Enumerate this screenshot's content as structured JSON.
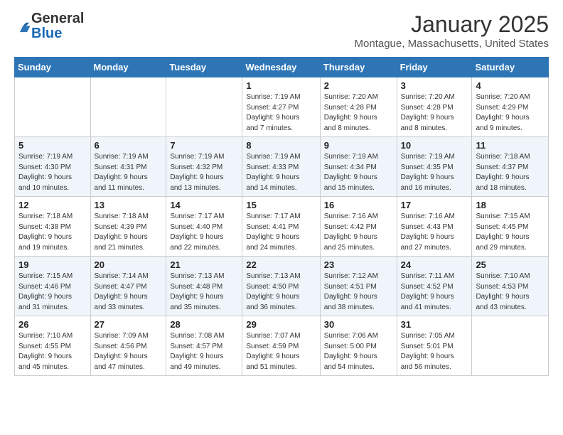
{
  "logo": {
    "general": "General",
    "blue": "Blue"
  },
  "header": {
    "month": "January 2025",
    "location": "Montague, Massachusetts, United States"
  },
  "weekdays": [
    "Sunday",
    "Monday",
    "Tuesday",
    "Wednesday",
    "Thursday",
    "Friday",
    "Saturday"
  ],
  "weeks": [
    [
      {
        "day": "",
        "info": ""
      },
      {
        "day": "",
        "info": ""
      },
      {
        "day": "",
        "info": ""
      },
      {
        "day": "1",
        "info": "Sunrise: 7:19 AM\nSunset: 4:27 PM\nDaylight: 9 hours\nand 7 minutes."
      },
      {
        "day": "2",
        "info": "Sunrise: 7:20 AM\nSunset: 4:28 PM\nDaylight: 9 hours\nand 8 minutes."
      },
      {
        "day": "3",
        "info": "Sunrise: 7:20 AM\nSunset: 4:28 PM\nDaylight: 9 hours\nand 8 minutes."
      },
      {
        "day": "4",
        "info": "Sunrise: 7:20 AM\nSunset: 4:29 PM\nDaylight: 9 hours\nand 9 minutes."
      }
    ],
    [
      {
        "day": "5",
        "info": "Sunrise: 7:19 AM\nSunset: 4:30 PM\nDaylight: 9 hours\nand 10 minutes."
      },
      {
        "day": "6",
        "info": "Sunrise: 7:19 AM\nSunset: 4:31 PM\nDaylight: 9 hours\nand 11 minutes."
      },
      {
        "day": "7",
        "info": "Sunrise: 7:19 AM\nSunset: 4:32 PM\nDaylight: 9 hours\nand 13 minutes."
      },
      {
        "day": "8",
        "info": "Sunrise: 7:19 AM\nSunset: 4:33 PM\nDaylight: 9 hours\nand 14 minutes."
      },
      {
        "day": "9",
        "info": "Sunrise: 7:19 AM\nSunset: 4:34 PM\nDaylight: 9 hours\nand 15 minutes."
      },
      {
        "day": "10",
        "info": "Sunrise: 7:19 AM\nSunset: 4:35 PM\nDaylight: 9 hours\nand 16 minutes."
      },
      {
        "day": "11",
        "info": "Sunrise: 7:18 AM\nSunset: 4:37 PM\nDaylight: 9 hours\nand 18 minutes."
      }
    ],
    [
      {
        "day": "12",
        "info": "Sunrise: 7:18 AM\nSunset: 4:38 PM\nDaylight: 9 hours\nand 19 minutes."
      },
      {
        "day": "13",
        "info": "Sunrise: 7:18 AM\nSunset: 4:39 PM\nDaylight: 9 hours\nand 21 minutes."
      },
      {
        "day": "14",
        "info": "Sunrise: 7:17 AM\nSunset: 4:40 PM\nDaylight: 9 hours\nand 22 minutes."
      },
      {
        "day": "15",
        "info": "Sunrise: 7:17 AM\nSunset: 4:41 PM\nDaylight: 9 hours\nand 24 minutes."
      },
      {
        "day": "16",
        "info": "Sunrise: 7:16 AM\nSunset: 4:42 PM\nDaylight: 9 hours\nand 25 minutes."
      },
      {
        "day": "17",
        "info": "Sunrise: 7:16 AM\nSunset: 4:43 PM\nDaylight: 9 hours\nand 27 minutes."
      },
      {
        "day": "18",
        "info": "Sunrise: 7:15 AM\nSunset: 4:45 PM\nDaylight: 9 hours\nand 29 minutes."
      }
    ],
    [
      {
        "day": "19",
        "info": "Sunrise: 7:15 AM\nSunset: 4:46 PM\nDaylight: 9 hours\nand 31 minutes."
      },
      {
        "day": "20",
        "info": "Sunrise: 7:14 AM\nSunset: 4:47 PM\nDaylight: 9 hours\nand 33 minutes."
      },
      {
        "day": "21",
        "info": "Sunrise: 7:13 AM\nSunset: 4:48 PM\nDaylight: 9 hours\nand 35 minutes."
      },
      {
        "day": "22",
        "info": "Sunrise: 7:13 AM\nSunset: 4:50 PM\nDaylight: 9 hours\nand 36 minutes."
      },
      {
        "day": "23",
        "info": "Sunrise: 7:12 AM\nSunset: 4:51 PM\nDaylight: 9 hours\nand 38 minutes."
      },
      {
        "day": "24",
        "info": "Sunrise: 7:11 AM\nSunset: 4:52 PM\nDaylight: 9 hours\nand 41 minutes."
      },
      {
        "day": "25",
        "info": "Sunrise: 7:10 AM\nSunset: 4:53 PM\nDaylight: 9 hours\nand 43 minutes."
      }
    ],
    [
      {
        "day": "26",
        "info": "Sunrise: 7:10 AM\nSunset: 4:55 PM\nDaylight: 9 hours\nand 45 minutes."
      },
      {
        "day": "27",
        "info": "Sunrise: 7:09 AM\nSunset: 4:56 PM\nDaylight: 9 hours\nand 47 minutes."
      },
      {
        "day": "28",
        "info": "Sunrise: 7:08 AM\nSunset: 4:57 PM\nDaylight: 9 hours\nand 49 minutes."
      },
      {
        "day": "29",
        "info": "Sunrise: 7:07 AM\nSunset: 4:59 PM\nDaylight: 9 hours\nand 51 minutes."
      },
      {
        "day": "30",
        "info": "Sunrise: 7:06 AM\nSunset: 5:00 PM\nDaylight: 9 hours\nand 54 minutes."
      },
      {
        "day": "31",
        "info": "Sunrise: 7:05 AM\nSunset: 5:01 PM\nDaylight: 9 hours\nand 56 minutes."
      },
      {
        "day": "",
        "info": ""
      }
    ]
  ]
}
